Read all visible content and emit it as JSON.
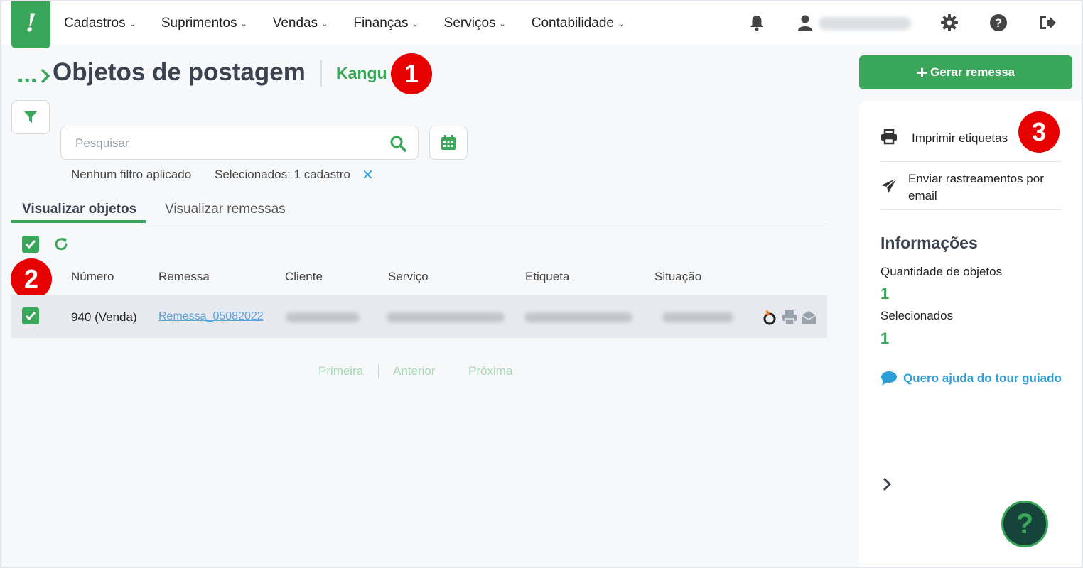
{
  "nav": {
    "logo": "!",
    "menu": [
      {
        "label": "Cadastros"
      },
      {
        "label": "Suprimentos"
      },
      {
        "label": "Vendas"
      },
      {
        "label": "Finanças"
      },
      {
        "label": "Serviços"
      },
      {
        "label": "Contabilidade"
      }
    ],
    "icons": [
      "bell-icon",
      "user-icon",
      "gear-icon",
      "help-circle-icon",
      "logout-icon"
    ]
  },
  "header": {
    "breadcrumb": "...",
    "title": "Objetos de postagem",
    "integration": "Kangu"
  },
  "badges": [
    "1",
    "2",
    "3"
  ],
  "search": {
    "placeholder": "Pesquisar",
    "value": ""
  },
  "filters": {
    "status": "Nenhum filtro aplicado",
    "selected": "Selecionados: 1 cadastro",
    "clear": "✕"
  },
  "tabs": [
    {
      "label": "Visualizar objetos",
      "active": true
    },
    {
      "label": "Visualizar remessas",
      "active": false
    }
  ],
  "table": {
    "columns": [
      "Número",
      "Remessa",
      "Cliente",
      "Serviço",
      "Etiqueta",
      "Situação"
    ],
    "rows": [
      {
        "numero": "940 (Venda)",
        "remessa": "Remessa_05082022",
        "checked": true
      }
    ]
  },
  "pagination": {
    "first": "Primeira",
    "prev": "Anterior",
    "next": "Próxima"
  },
  "side": {
    "generate_button": "Gerar remessa",
    "actions": [
      {
        "label": "Imprimir etiquetas"
      },
      {
        "label": "Enviar rastreamentos por email"
      }
    ],
    "info_title": "Informações",
    "qty_label": "Quantidade de objetos",
    "qty_value": "1",
    "sel_label": "Selecionados",
    "sel_value": "1",
    "tour": "Quero ajuda do tour guiado",
    "help": "?"
  },
  "colors": {
    "accent": "#3aa65a",
    "link": "#2a9fd8",
    "badge": "#e60000"
  }
}
